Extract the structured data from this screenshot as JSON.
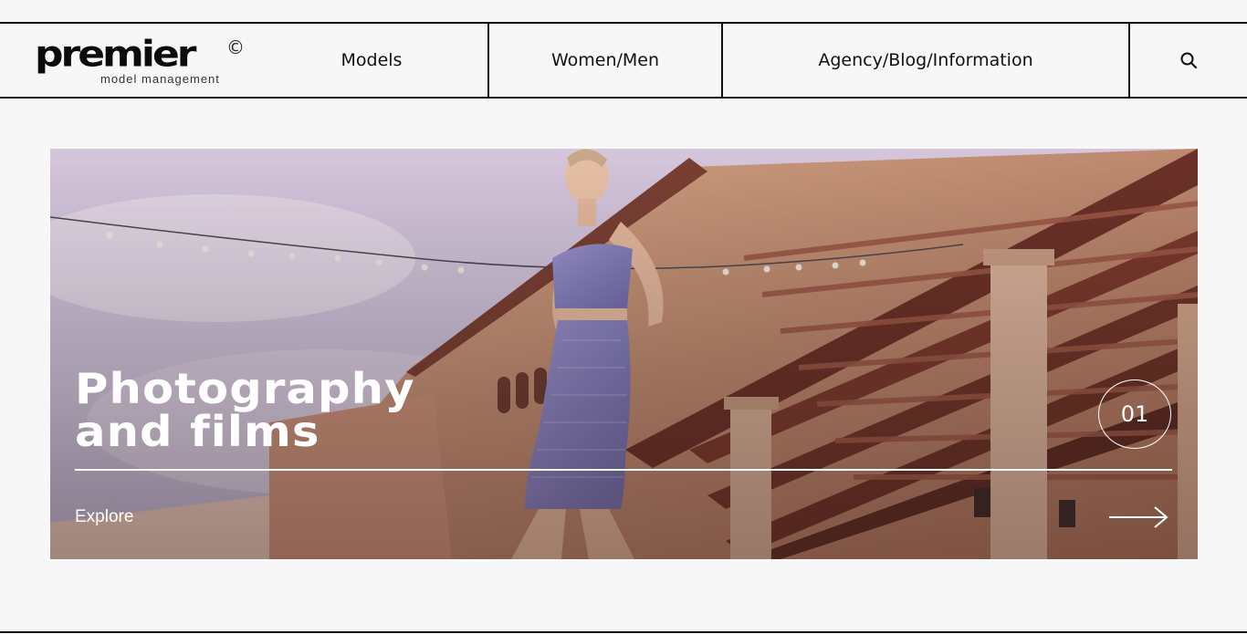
{
  "brand": {
    "name": "premier",
    "copyright_mark": "©",
    "tagline": "model management"
  },
  "nav": {
    "items": [
      {
        "label": "Models"
      },
      {
        "label": "Women/Men"
      },
      {
        "label": "Agency/Blog/Information"
      }
    ],
    "search_icon": "search-icon"
  },
  "hero": {
    "title_line1": "Photography",
    "title_line2": "and films",
    "counter": "01",
    "cta_label": "Explore",
    "cta_icon": "arrow-right-icon",
    "image_subject": "model in lavender dress in front of terracotta building with pergola"
  },
  "colors": {
    "background": "#f7f7f7",
    "text": "#111111",
    "hero_text": "#ffffff"
  }
}
